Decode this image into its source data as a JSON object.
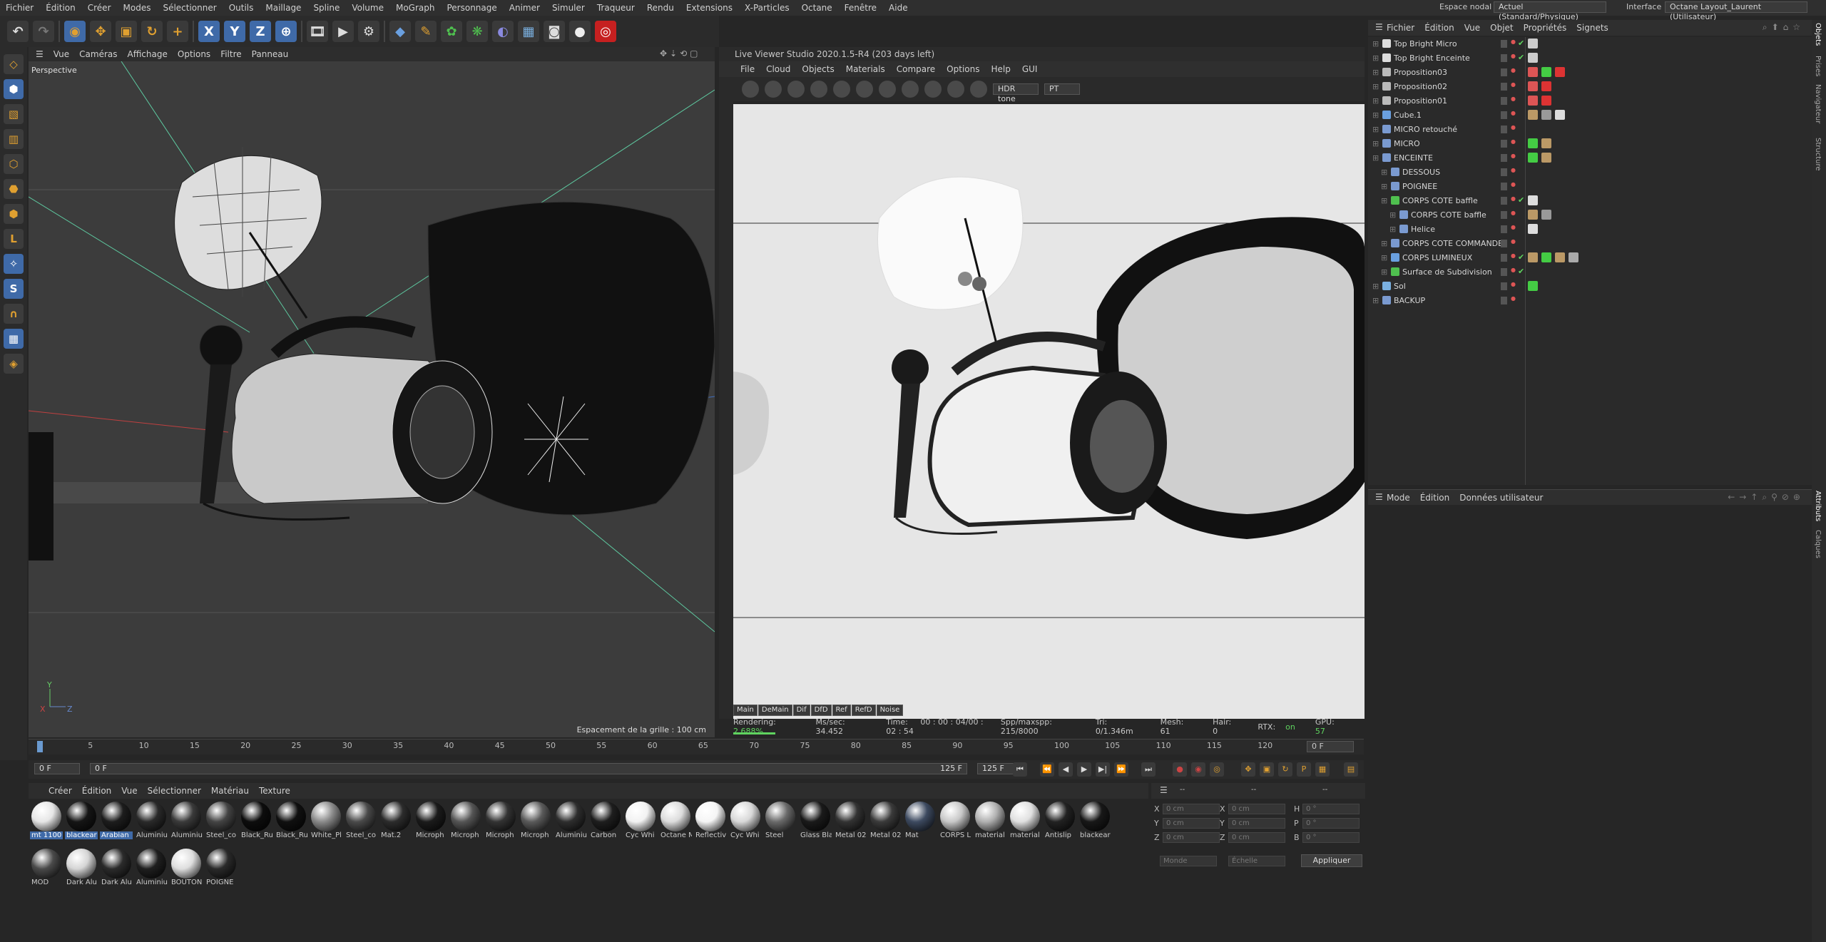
{
  "menubar": {
    "items": [
      "Fichier",
      "Édition",
      "Créer",
      "Modes",
      "Sélectionner",
      "Outils",
      "Maillage",
      "Spline",
      "Volume",
      "MoGraph",
      "Personnage",
      "Animer",
      "Simuler",
      "Traqueur",
      "Rendu",
      "Extensions",
      "X-Particles",
      "Octane",
      "Fenêtre",
      "Aide"
    ],
    "nodal_label": "Espace nodal :",
    "nodal_value": "Actuel (Standard/Physique)",
    "interface_label": "Interface :",
    "interface_value": "Octane Layout_Laurent (Utilisateur)"
  },
  "toolbar": {
    "icons": [
      "undo-icon",
      "redo-icon",
      "live-selection-icon",
      "move-icon",
      "scale-icon",
      "rotate-icon",
      "add-icon",
      "x-axis-icon",
      "y-axis-icon",
      "z-axis-icon",
      "world-coords-icon",
      "render-region-icon",
      "render-view-icon",
      "render-settings-icon",
      "cube-icon",
      "pen-icon",
      "subdivision-icon",
      "cloner-icon",
      "deformer-icon",
      "floor-icon",
      "camera-icon",
      "light-icon",
      "octane-render-icon"
    ],
    "x": "X",
    "y": "Y",
    "z": "Z"
  },
  "viewport": {
    "menu": [
      "Vue",
      "Caméras",
      "Affichage",
      "Options",
      "Filtre",
      "Panneau"
    ],
    "label": "Perspective",
    "grid_label": "Espacement de la grille : 100 cm",
    "axis_x": "X",
    "axis_y": "Y",
    "axis_z": "Z"
  },
  "live_viewer": {
    "title": "Live Viewer Studio 2020.1.5-R4 (203 days left)",
    "menu": [
      "File",
      "Cloud",
      "Objects",
      "Materials",
      "Compare",
      "Options",
      "Help",
      "GUI"
    ],
    "tonemap": "HDR tone",
    "kernel": "PT",
    "tabs": [
      "Main",
      "DeMain",
      "Dif",
      "DfD",
      "Ref",
      "RefD",
      "Noise"
    ],
    "status": {
      "rendering_label": "Rendering:",
      "rendering_value": "2.688%",
      "mssec_label": "Ms/sec:",
      "mssec_value": "34.452",
      "time_label": "Time:",
      "time_value": "00 : 00 : 04/00 : 02 : 54",
      "spp_label": "Spp/maxspp:",
      "spp_value": "215/8000",
      "tri_label": "Tri:",
      "tri_value": "0/1.346m",
      "mesh_label": "Mesh:",
      "mesh_value": "61",
      "hair_label": "Hair:",
      "hair_value": "0",
      "rtx_label": "RTX:",
      "rtx_value": "on",
      "gpu_label": "GPU:",
      "gpu_value": "57"
    },
    "progress": 0.02688
  },
  "timeline": {
    "ticks": [
      "0",
      "5",
      "10",
      "15",
      "20",
      "25",
      "30",
      "35",
      "40",
      "45",
      "50",
      "55",
      "60",
      "65",
      "70",
      "75",
      "80",
      "85",
      "90",
      "95",
      "100",
      "105",
      "110",
      "115",
      "120",
      "125"
    ],
    "current_frame": "0 F",
    "start": "0 F",
    "start2": "0 F",
    "end_a": "125 F",
    "end_b": "125 F"
  },
  "materials": {
    "menu": [
      "Créer",
      "Édition",
      "Vue",
      "Sélectionner",
      "Matériau",
      "Texture"
    ],
    "items": [
      {
        "label": "mt 1100",
        "color": "#e6e6e6",
        "sel": true
      },
      {
        "label": "blackear",
        "color": "#151515",
        "sel": true
      },
      {
        "label": "Arabian",
        "color": "#1d1d1d",
        "sel": true
      },
      {
        "label": "Aluminiu",
        "color": "#2a2a2a"
      },
      {
        "label": "Aluminiu",
        "color": "#3a3a3a"
      },
      {
        "label": "Steel_co",
        "color": "#444"
      },
      {
        "label": "Black_Ru",
        "color": "#0d0d0d"
      },
      {
        "label": "Black_Ru",
        "color": "#101010"
      },
      {
        "label": "White_Pl",
        "color": "#8a8a8a"
      },
      {
        "label": "Steel_co",
        "color": "#4a4a4a"
      },
      {
        "label": "Mat.2",
        "color": "#2c2c2c"
      },
      {
        "label": "Microph",
        "color": "#1b1b1b"
      },
      {
        "label": "Microph",
        "color": "#555"
      },
      {
        "label": "Microph",
        "color": "#333"
      },
      {
        "label": "Microph",
        "color": "#5a5a5a"
      },
      {
        "label": "Aluminiu",
        "color": "#2e2e2e"
      },
      {
        "label": "Carbon",
        "color": "#1e1e1e"
      },
      {
        "label": "Cyc Whi",
        "color": "#f2f2f2"
      },
      {
        "label": "Octane M",
        "color": "#dcdcdc"
      },
      {
        "label": "Reflectiv",
        "color": "#f5f5f5"
      },
      {
        "label": "Cyc Whi",
        "color": "#d8d8d8"
      },
      {
        "label": "Steel",
        "color": "#6a6a6a"
      },
      {
        "label": "Glass Bla",
        "color": "#1a1a1a"
      },
      {
        "label": "Metal 02",
        "color": "#333"
      },
      {
        "label": "Metal 02",
        "color": "#3a3a3a"
      },
      {
        "label": "Mat",
        "color": "#3d4a60"
      },
      {
        "label": "CORPS L",
        "color": "#c8c8c8"
      },
      {
        "label": "material",
        "color": "#b0b0b0"
      },
      {
        "label": "material",
        "color": "#e0e0e0"
      },
      {
        "label": "Antislip",
        "color": "#222"
      },
      {
        "label": "blackear",
        "color": "#181818"
      },
      {
        "label": "MOD",
        "color": "#4a4a4a"
      },
      {
        "label": "Dark Alu",
        "color": "#d5d5d5"
      },
      {
        "label": "Dark Alu",
        "color": "#2b2b2b"
      },
      {
        "label": "Aluminiu",
        "color": "#1f1f1f"
      },
      {
        "label": "BOUTON",
        "color": "#dedede"
      },
      {
        "label": "POIGNE",
        "color": "#2a2a2a"
      }
    ]
  },
  "coordinates": {
    "rows": [
      {
        "a": "X",
        "av": "0 cm",
        "b": "X",
        "bv": "0 cm",
        "c": "H",
        "cv": "0 °"
      },
      {
        "a": "Y",
        "av": "0 cm",
        "b": "Y",
        "bv": "0 cm",
        "c": "P",
        "cv": "0 °"
      },
      {
        "a": "Z",
        "av": "0 cm",
        "b": "Z",
        "bv": "0 cm",
        "c": "B",
        "cv": "0 °"
      }
    ],
    "mode": "Monde",
    "scale": "Échelle",
    "apply": "Appliquer",
    "top_a": "--",
    "top_b": "--",
    "top_c": "--"
  },
  "object_manager": {
    "menu": [
      "Fichier",
      "Édition",
      "Vue",
      "Objet",
      "Propriétés",
      "Signets"
    ],
    "objects": [
      {
        "name": "Top Bright Micro",
        "indent": 0,
        "icon": "light-icon",
        "check": true
      },
      {
        "name": "Top Bright Enceinte",
        "indent": 0,
        "icon": "light-icon",
        "check": true
      },
      {
        "name": "Proposition03",
        "indent": 0,
        "icon": "camera-icon",
        "check": false
      },
      {
        "name": "Proposition02",
        "indent": 0,
        "icon": "camera-icon",
        "check": false
      },
      {
        "name": "Proposition01",
        "indent": 0,
        "icon": "camera-icon",
        "check": false
      },
      {
        "name": "Cube.1",
        "indent": 0,
        "icon": "cube-icon",
        "check": false
      },
      {
        "name": "MICRO retouché",
        "indent": 0,
        "icon": "null-icon",
        "check": false
      },
      {
        "name": "MICRO",
        "indent": 0,
        "icon": "null-icon",
        "check": false
      },
      {
        "name": "ENCEINTE",
        "indent": 0,
        "icon": "null-icon",
        "check": false
      },
      {
        "name": "DESSOUS",
        "indent": 1,
        "icon": "null-icon",
        "check": false
      },
      {
        "name": "POIGNEE",
        "indent": 1,
        "icon": "null-icon",
        "check": false
      },
      {
        "name": "CORPS COTE  baffle",
        "indent": 1,
        "icon": "subdivision-icon",
        "check": true
      },
      {
        "name": "CORPS COTE  baffle",
        "indent": 2,
        "icon": "null-icon",
        "check": false
      },
      {
        "name": "Helice",
        "indent": 2,
        "icon": "null-icon",
        "check": false
      },
      {
        "name": "CORPS COTE COMMANDE",
        "indent": 1,
        "icon": "null-icon",
        "check": false
      },
      {
        "name": "CORPS LUMINEUX",
        "indent": 1,
        "icon": "polygon-icon",
        "check": true
      },
      {
        "name": "Surface de Subdivision",
        "indent": 1,
        "icon": "subdivision-icon",
        "check": true
      },
      {
        "name": "Sol",
        "indent": 0,
        "icon": "floor-icon",
        "check": false
      },
      {
        "name": "BACKUP",
        "indent": 0,
        "icon": "null-icon",
        "check": false
      }
    ]
  },
  "attributes": {
    "menu": [
      "Mode",
      "Édition",
      "Données utilisateur"
    ]
  },
  "side_tabs": {
    "top": [
      "Objets",
      "Prises",
      "Navigateur",
      "Structure"
    ],
    "bottom": [
      "Attributs",
      "Calques"
    ]
  }
}
